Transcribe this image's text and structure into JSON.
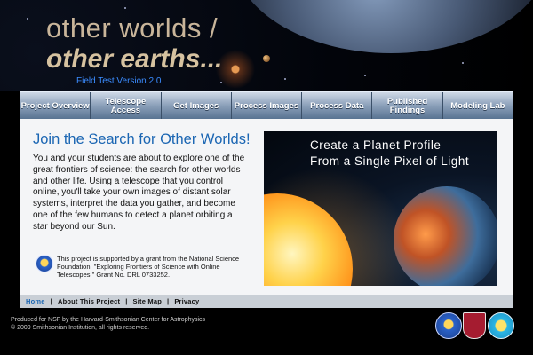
{
  "header": {
    "brand_line_1": "other worlds /",
    "brand_line_2": "other earths...",
    "version": "Field Test Version 2.0"
  },
  "nav": {
    "items": [
      {
        "label": "Project Overview"
      },
      {
        "label": "Telescope Access"
      },
      {
        "label": "Get Images"
      },
      {
        "label": "Process Images"
      },
      {
        "label": "Process Data"
      },
      {
        "label": "Published Findings"
      },
      {
        "label": "Modeling Lab"
      }
    ]
  },
  "main": {
    "title": "Join the Search for Other Worlds!",
    "intro": "You and your students are about to explore one of the great frontiers of science: the search for other worlds and other life. Using a telescope that you control online, you'll take your own images of distant solar systems, interpret the data you gather, and become one of the few humans to detect a planet orbiting a star beyond our Sun.",
    "grant_text": "This project is supported by a grant from the National Science Foundation, \"Exploring Frontiers of Science with Online Telescopes,\" Grant No. DRL 0733252.",
    "promo_line_1": "Create a Planet Profile",
    "promo_line_2": "From a Single Pixel of Light"
  },
  "footer": {
    "links": [
      {
        "label": "Home"
      },
      {
        "label": "About This Project"
      },
      {
        "label": "Site Map"
      },
      {
        "label": "Privacy"
      }
    ],
    "separator": "|",
    "credit_line_1": "Produced for NSF by the Harvard-Smithsonian Center for Astrophysics",
    "credit_line_2": "© 2009 Smithsonian Institution, all rights reserved."
  },
  "colors": {
    "accent": "#1b66b3",
    "brand_text": "#d6c2a0",
    "version_text": "#3b8cff"
  }
}
